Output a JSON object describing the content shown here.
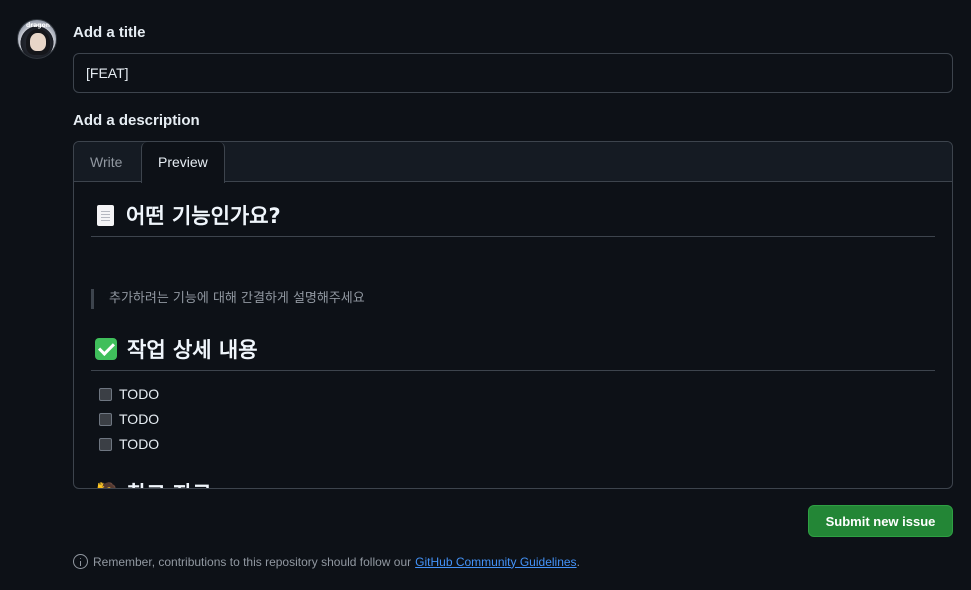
{
  "title_section": {
    "label": "Add a title",
    "value": "[FEAT]"
  },
  "description_section": {
    "label": "Add a description",
    "tabs": [
      {
        "label": "Write",
        "active": false
      },
      {
        "label": "Preview",
        "active": true
      }
    ]
  },
  "preview": {
    "heading1": {
      "icon": "page-icon",
      "text": "어떤 기능인가요?"
    },
    "quote": "추가하려는 기능에 대해 간결하게 설명해주세요",
    "heading2": {
      "icon": "check-mark-button-icon",
      "text": "작업 상세 내용"
    },
    "tasks": [
      {
        "label": "TODO",
        "checked": false
      },
      {
        "label": "TODO",
        "checked": false
      },
      {
        "label": "TODO",
        "checked": false
      }
    ],
    "heading3": {
      "icon": "person-raising-hand-icon",
      "text": "참고 자료"
    }
  },
  "submit_button": {
    "label": "Submit new issue",
    "color": "#238636"
  },
  "footer": {
    "text": "Remember, contributions to this repository should follow our",
    "link_text": "GitHub Community Guidelines",
    "suffix": "."
  },
  "avatar": {
    "caption": "dragon"
  },
  "colors": {
    "background": "#0d1117",
    "link": "#4493f8",
    "border": "#3d444d"
  }
}
